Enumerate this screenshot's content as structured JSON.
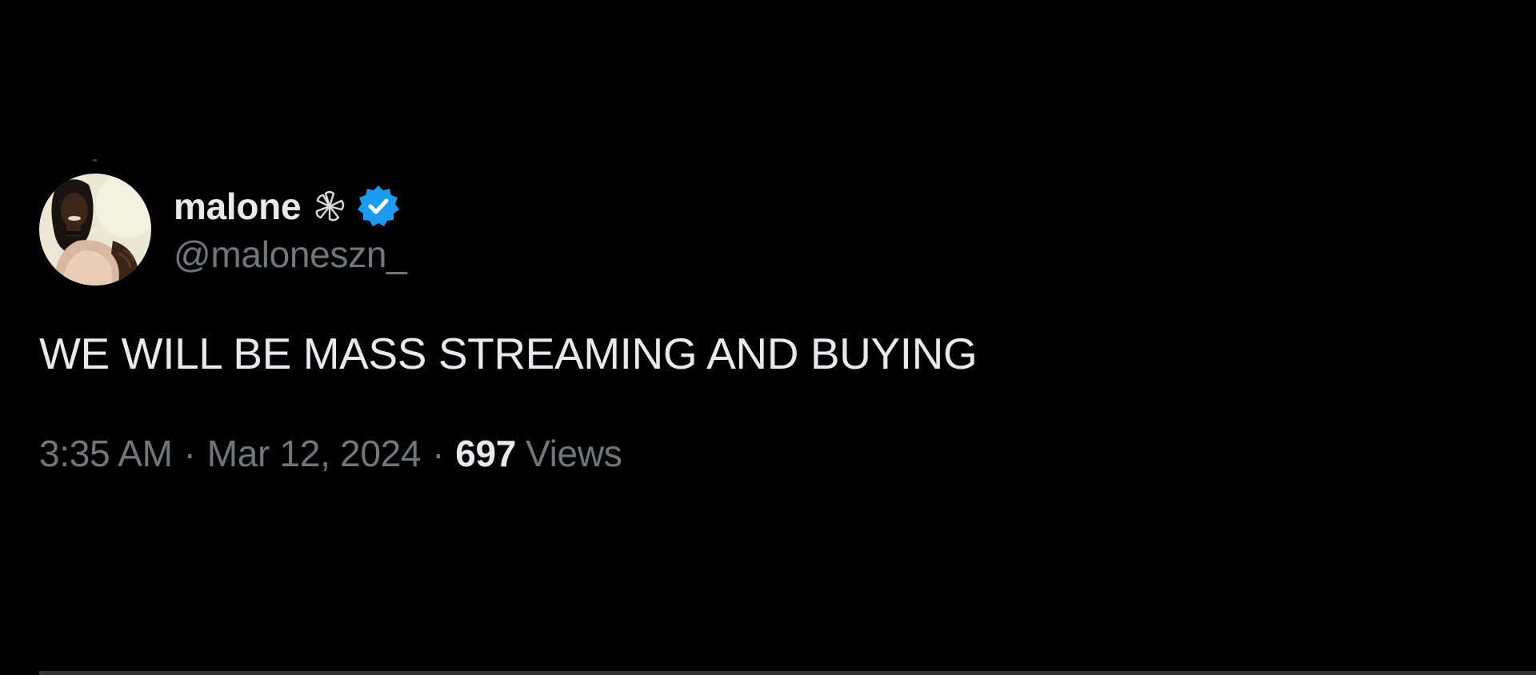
{
  "tweet": {
    "author": {
      "display_name": "malone",
      "name_emoji_icon": "white-flower-icon",
      "verified_icon": "verified-badge-icon",
      "handle": "@maloneszn_",
      "avatar_icon": "avatar"
    },
    "text": "WE WILL BE MASS STREAMING AND BUYING",
    "time": "3:35 AM",
    "separator": "·",
    "date": "Mar 12, 2024",
    "views_count": "697",
    "views_label": "Views"
  },
  "colors": {
    "background": "#000000",
    "primary_text": "#e7e9ea",
    "secondary_text": "#71767b",
    "verified_blue": "#1d9bf0",
    "divider": "#2f3336"
  }
}
